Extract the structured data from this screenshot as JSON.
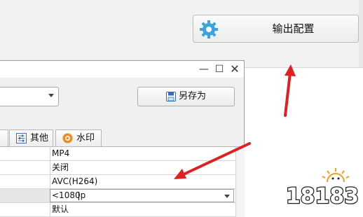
{
  "header": {
    "export_button_label": "输出配置"
  },
  "dialog": {
    "controls": {
      "minimize": "—",
      "maximize": "☐",
      "close": "✕"
    },
    "save_as_label": "另存为",
    "tabs": [
      {
        "label": "其他",
        "icon": "sliders-icon"
      },
      {
        "label": "水印",
        "icon": "watermark-icon"
      }
    ],
    "properties": [
      {
        "value": "MP4"
      },
      {
        "value": "关闭"
      },
      {
        "value": "AVC(H264)"
      },
      {
        "value": "<1080p",
        "editing": true
      },
      {
        "value": "默认"
      }
    ]
  },
  "watermark": {
    "text": "18183"
  },
  "colors": {
    "gear": "#3ba4dc",
    "arrow": "#e02020",
    "logo_outline": "#1f1f1f",
    "logo_fill": "#ffffff",
    "sun": "#f0a020"
  }
}
